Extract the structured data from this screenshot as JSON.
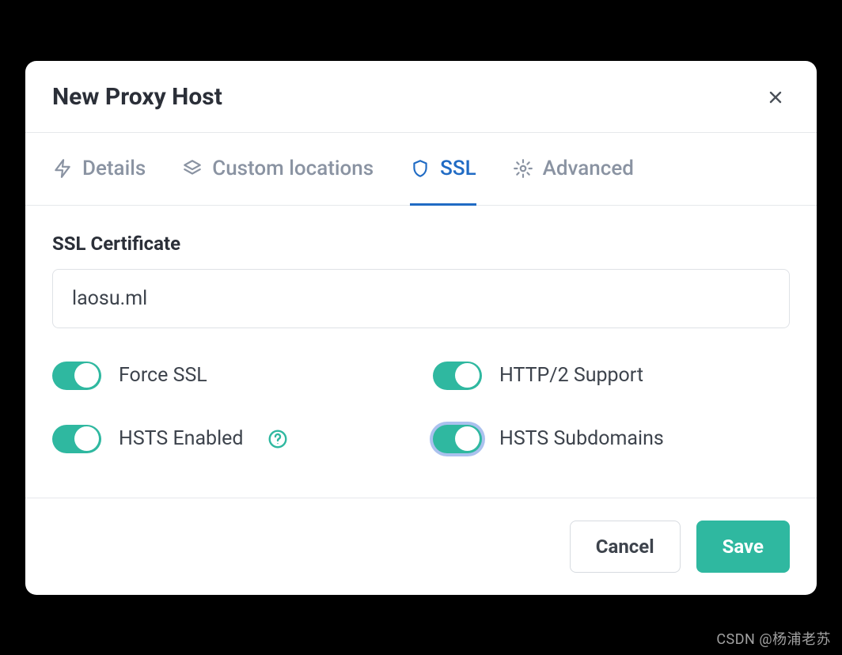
{
  "modal": {
    "title": "New Proxy Host"
  },
  "tabs": {
    "details": "Details",
    "custom_locations": "Custom locations",
    "ssl": "SSL",
    "advanced": "Advanced"
  },
  "ssl": {
    "cert_label": "SSL Certificate",
    "cert_value": "laosu.ml",
    "toggles": {
      "force_ssl": {
        "label": "Force SSL",
        "on": true
      },
      "http2": {
        "label": "HTTP/2 Support",
        "on": true
      },
      "hsts": {
        "label": "HSTS Enabled",
        "on": true
      },
      "hsts_sub": {
        "label": "HSTS Subdomains",
        "on": true,
        "focus": true
      }
    }
  },
  "footer": {
    "cancel": "Cancel",
    "save": "Save"
  },
  "watermark": "CSDN @杨浦老苏"
}
